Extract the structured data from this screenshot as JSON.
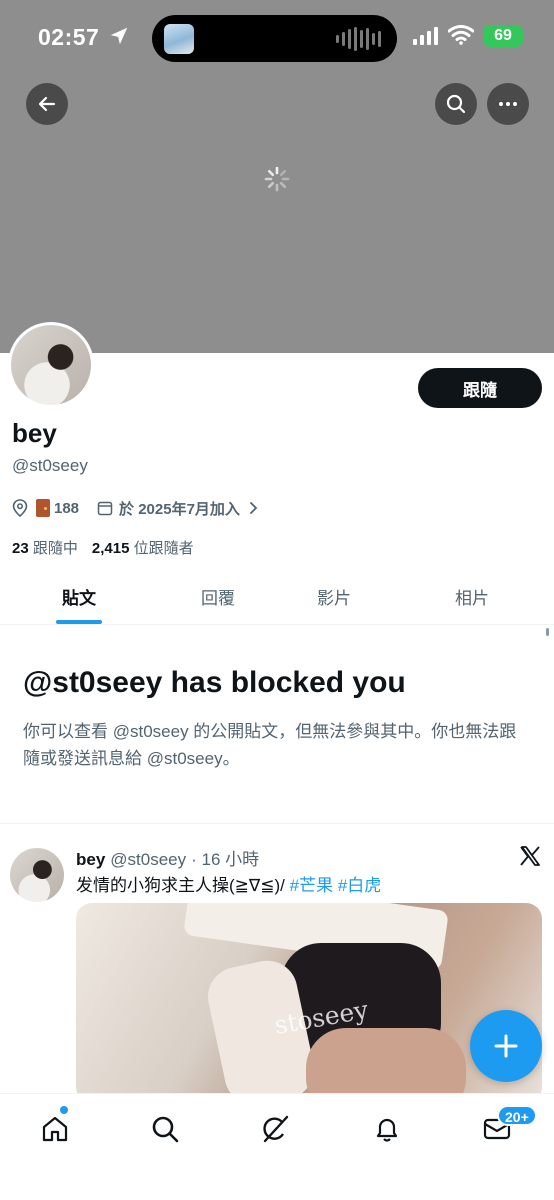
{
  "status_bar": {
    "time": "02:57",
    "battery": "69"
  },
  "profile": {
    "name": "bey",
    "handle": "@st0seey",
    "location": "188",
    "joined": "於 2025年7月加入",
    "following_count": "23",
    "following_label": "跟隨中",
    "followers_count": "2,415",
    "followers_label": "位跟隨者",
    "follow_button": "跟隨"
  },
  "tabs": [
    {
      "label": "貼文",
      "active": true
    },
    {
      "label": "回覆",
      "active": false
    },
    {
      "label": "影片",
      "active": false
    },
    {
      "label": "相片",
      "active": false
    }
  ],
  "blocked": {
    "title": "@st0seey has blocked you",
    "body": "你可以查看 @st0seey 的公開貼文，但無法參與其中。你也無法跟隨或發送訊息給 @st0seey。"
  },
  "post": {
    "author": "bey",
    "handle": "@st0seey",
    "time": "· 16 小時",
    "text": "发情的小狗求主人操(≧∇≦)/ ",
    "tag1": "#芒果",
    "tag2": "#白虎",
    "watermark": "stoseey"
  },
  "bottom_nav": {
    "messages_badge": "20+"
  },
  "colors": {
    "accent": "#1d9bf0",
    "text": "#0f1419",
    "secondary": "#536471",
    "banner": "#8e8e8e"
  }
}
